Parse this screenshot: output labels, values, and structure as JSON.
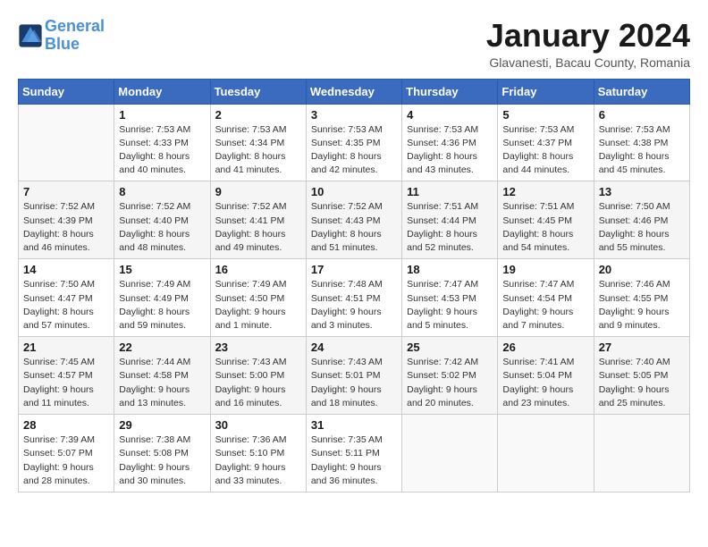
{
  "header": {
    "logo_line1": "General",
    "logo_line2": "Blue",
    "month": "January 2024",
    "location": "Glavanesti, Bacau County, Romania"
  },
  "days_of_week": [
    "Sunday",
    "Monday",
    "Tuesday",
    "Wednesday",
    "Thursday",
    "Friday",
    "Saturday"
  ],
  "weeks": [
    [
      {
        "day": "",
        "info": ""
      },
      {
        "day": "1",
        "info": "Sunrise: 7:53 AM\nSunset: 4:33 PM\nDaylight: 8 hours\nand 40 minutes."
      },
      {
        "day": "2",
        "info": "Sunrise: 7:53 AM\nSunset: 4:34 PM\nDaylight: 8 hours\nand 41 minutes."
      },
      {
        "day": "3",
        "info": "Sunrise: 7:53 AM\nSunset: 4:35 PM\nDaylight: 8 hours\nand 42 minutes."
      },
      {
        "day": "4",
        "info": "Sunrise: 7:53 AM\nSunset: 4:36 PM\nDaylight: 8 hours\nand 43 minutes."
      },
      {
        "day": "5",
        "info": "Sunrise: 7:53 AM\nSunset: 4:37 PM\nDaylight: 8 hours\nand 44 minutes."
      },
      {
        "day": "6",
        "info": "Sunrise: 7:53 AM\nSunset: 4:38 PM\nDaylight: 8 hours\nand 45 minutes."
      }
    ],
    [
      {
        "day": "7",
        "info": "Sunrise: 7:52 AM\nSunset: 4:39 PM\nDaylight: 8 hours\nand 46 minutes."
      },
      {
        "day": "8",
        "info": "Sunrise: 7:52 AM\nSunset: 4:40 PM\nDaylight: 8 hours\nand 48 minutes."
      },
      {
        "day": "9",
        "info": "Sunrise: 7:52 AM\nSunset: 4:41 PM\nDaylight: 8 hours\nand 49 minutes."
      },
      {
        "day": "10",
        "info": "Sunrise: 7:52 AM\nSunset: 4:43 PM\nDaylight: 8 hours\nand 51 minutes."
      },
      {
        "day": "11",
        "info": "Sunrise: 7:51 AM\nSunset: 4:44 PM\nDaylight: 8 hours\nand 52 minutes."
      },
      {
        "day": "12",
        "info": "Sunrise: 7:51 AM\nSunset: 4:45 PM\nDaylight: 8 hours\nand 54 minutes."
      },
      {
        "day": "13",
        "info": "Sunrise: 7:50 AM\nSunset: 4:46 PM\nDaylight: 8 hours\nand 55 minutes."
      }
    ],
    [
      {
        "day": "14",
        "info": "Sunrise: 7:50 AM\nSunset: 4:47 PM\nDaylight: 8 hours\nand 57 minutes."
      },
      {
        "day": "15",
        "info": "Sunrise: 7:49 AM\nSunset: 4:49 PM\nDaylight: 8 hours\nand 59 minutes."
      },
      {
        "day": "16",
        "info": "Sunrise: 7:49 AM\nSunset: 4:50 PM\nDaylight: 9 hours\nand 1 minute."
      },
      {
        "day": "17",
        "info": "Sunrise: 7:48 AM\nSunset: 4:51 PM\nDaylight: 9 hours\nand 3 minutes."
      },
      {
        "day": "18",
        "info": "Sunrise: 7:47 AM\nSunset: 4:53 PM\nDaylight: 9 hours\nand 5 minutes."
      },
      {
        "day": "19",
        "info": "Sunrise: 7:47 AM\nSunset: 4:54 PM\nDaylight: 9 hours\nand 7 minutes."
      },
      {
        "day": "20",
        "info": "Sunrise: 7:46 AM\nSunset: 4:55 PM\nDaylight: 9 hours\nand 9 minutes."
      }
    ],
    [
      {
        "day": "21",
        "info": "Sunrise: 7:45 AM\nSunset: 4:57 PM\nDaylight: 9 hours\nand 11 minutes."
      },
      {
        "day": "22",
        "info": "Sunrise: 7:44 AM\nSunset: 4:58 PM\nDaylight: 9 hours\nand 13 minutes."
      },
      {
        "day": "23",
        "info": "Sunrise: 7:43 AM\nSunset: 5:00 PM\nDaylight: 9 hours\nand 16 minutes."
      },
      {
        "day": "24",
        "info": "Sunrise: 7:43 AM\nSunset: 5:01 PM\nDaylight: 9 hours\nand 18 minutes."
      },
      {
        "day": "25",
        "info": "Sunrise: 7:42 AM\nSunset: 5:02 PM\nDaylight: 9 hours\nand 20 minutes."
      },
      {
        "day": "26",
        "info": "Sunrise: 7:41 AM\nSunset: 5:04 PM\nDaylight: 9 hours\nand 23 minutes."
      },
      {
        "day": "27",
        "info": "Sunrise: 7:40 AM\nSunset: 5:05 PM\nDaylight: 9 hours\nand 25 minutes."
      }
    ],
    [
      {
        "day": "28",
        "info": "Sunrise: 7:39 AM\nSunset: 5:07 PM\nDaylight: 9 hours\nand 28 minutes."
      },
      {
        "day": "29",
        "info": "Sunrise: 7:38 AM\nSunset: 5:08 PM\nDaylight: 9 hours\nand 30 minutes."
      },
      {
        "day": "30",
        "info": "Sunrise: 7:36 AM\nSunset: 5:10 PM\nDaylight: 9 hours\nand 33 minutes."
      },
      {
        "day": "31",
        "info": "Sunrise: 7:35 AM\nSunset: 5:11 PM\nDaylight: 9 hours\nand 36 minutes."
      },
      {
        "day": "",
        "info": ""
      },
      {
        "day": "",
        "info": ""
      },
      {
        "day": "",
        "info": ""
      }
    ]
  ]
}
